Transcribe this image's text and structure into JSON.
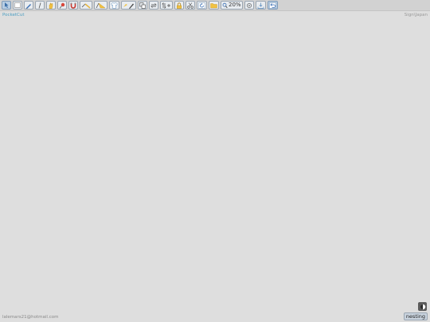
{
  "app": {
    "title": "PocketCut",
    "user_link": "Sign\\Japan",
    "footer_email": "lalemars21@hotmail.com"
  },
  "toolbar": {
    "zoom_value": "20%",
    "icons": [
      "select-icon",
      "new-sheet-icon",
      "pencil-icon",
      "line-icon",
      "hand-icon",
      "pin-icon",
      "magnet-icon",
      "measure-icon",
      "ruler-icon",
      "shirt-icon",
      "pen-tool-icon",
      "copy-icon",
      "swap-icon",
      "flip-icon",
      "lock-icon",
      "scissors-icon",
      "rotate-icon",
      "folder-icon",
      "zoom-icon",
      "target-icon",
      "download-icon",
      "undo-icon"
    ]
  },
  "footer": {
    "nesting_label": "nesting",
    "theme_icon": "contrast-icon"
  },
  "colors": {
    "canvas": "#dedede",
    "toolbar": "#d2d2d2",
    "title": "#4c9ec2",
    "button_border": "#9aa6b2"
  }
}
